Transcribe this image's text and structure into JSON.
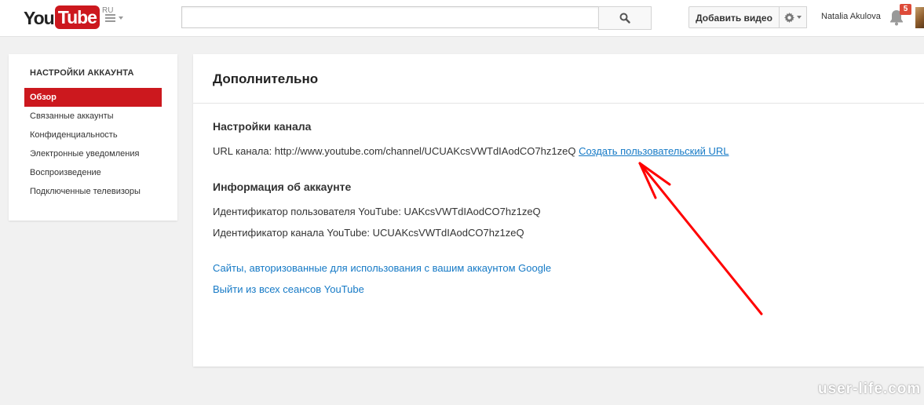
{
  "header": {
    "logo": {
      "you": "You",
      "tube": "Tube",
      "region": "RU"
    },
    "search": {
      "value": "",
      "placeholder": ""
    },
    "upload_label": "Добавить видео",
    "username": "Natalia Akulova",
    "notification_count": "5",
    "icons": [
      "guide-menu-icon",
      "search-icon",
      "gear-icon",
      "bell-icon",
      "avatar"
    ]
  },
  "sidebar": {
    "title": "НАСТРОЙКИ АККАУНТА",
    "items": [
      {
        "label": "Обзор",
        "active": true
      },
      {
        "label": "Связанные аккаунты"
      },
      {
        "label": "Конфиденциальность"
      },
      {
        "label": "Электронные уведомления"
      },
      {
        "label": "Воспроизведение"
      },
      {
        "label": "Подключенные телевизоры"
      }
    ]
  },
  "main": {
    "title": "Дополнительно",
    "channel_settings": {
      "title": "Настройки канала",
      "url_label": "URL канала: http://www.youtube.com/channel/UCUAKcsVWTdIAodCO7hz1zeQ",
      "custom_url_link": "Создать пользовательский URL"
    },
    "account_info": {
      "title": "Информация об аккаунте",
      "user_id": "Идентификатор пользователя YouTube: UAKcsVWTdIAodCO7hz1zeQ",
      "channel_id": "Идентификатор канала YouTube: UCUAKcsVWTdIAodCO7hz1zeQ"
    },
    "links": {
      "authorized_sites": "Сайты, авторизованные для использования с вашим аккаунтом Google",
      "sign_out_all": "Выйти из всех сеансов YouTube"
    }
  },
  "watermark": "user-life.com",
  "colors": {
    "brand_red": "#cc181e",
    "link_blue": "#167ac6",
    "annotation_red": "#ff0000",
    "badge": "#dd4b39"
  }
}
